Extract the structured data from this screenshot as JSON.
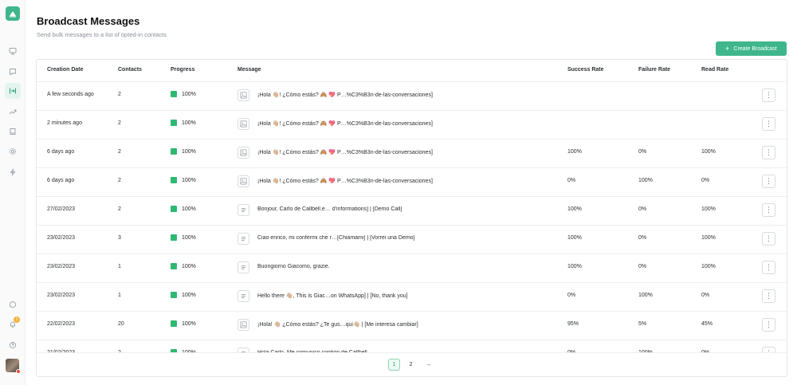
{
  "sidebar": {
    "logo": "whatsapp-home-logo",
    "items": [
      {
        "name": "monitor-icon"
      },
      {
        "name": "chat-icon"
      },
      {
        "name": "broadcast-icon",
        "active": true
      },
      {
        "name": "trending-icon"
      },
      {
        "name": "book-icon"
      },
      {
        "name": "settings-icon"
      },
      {
        "name": "lightning-icon"
      }
    ],
    "bottom": [
      {
        "name": "whatsapp-icon"
      },
      {
        "name": "bell-icon",
        "badge": "1"
      },
      {
        "name": "help-icon"
      }
    ]
  },
  "header": {
    "title": "Broadcast Messages",
    "subtitle": "Send bulk messages to a list of opted-in contacts",
    "create_button": "Create Broadcast",
    "create_icon": "+"
  },
  "accent_color": "#3fb68b",
  "table": {
    "columns": [
      "Creation Date",
      "Contacts",
      "Progress",
      "Message",
      "Success Rate",
      "Failure Rate",
      "Read Rate"
    ],
    "rows": [
      {
        "date": "A few seconds ago",
        "contacts": "2",
        "progress": "100%",
        "icon": "image-icon",
        "message": "¡Hola 👋🏼! ¿Cómo estás? 🙈 💖 P…%C3%B3n-de-las-conversaciones]",
        "success": "",
        "failure": "",
        "read": ""
      },
      {
        "date": "2 minutes ago",
        "contacts": "2",
        "progress": "100%",
        "icon": "image-icon",
        "message": "¡Hola 👋🏼! ¿Cómo estás? 🙈 💖 P…%C3%B3n-de-las-conversaciones]",
        "success": "",
        "failure": "",
        "read": ""
      },
      {
        "date": "6 days ago",
        "contacts": "2",
        "progress": "100%",
        "icon": "image-icon",
        "message": "¡Hola 👋🏼! ¿Cómo estás? 🙈 💖 P…%C3%B3n-de-las-conversaciones]",
        "success": "100%",
        "failure": "0%",
        "read": "100%"
      },
      {
        "date": "6 days ago",
        "contacts": "2",
        "progress": "100%",
        "icon": "image-icon",
        "message": "¡Hola 👋🏼! ¿Cómo estás? 🙈 💖 P…%C3%B3n-de-las-conversaciones]",
        "success": "0%",
        "failure": "100%",
        "read": "0%"
      },
      {
        "date": "27/02/2023",
        "contacts": "2",
        "progress": "100%",
        "icon": "text-icon",
        "message": "Bonjour, Carlo de Callbell.e… d'informations] | [Demo Call]",
        "success": "100%",
        "failure": "0%",
        "read": "100%"
      },
      {
        "date": "23/02/2023",
        "contacts": "3",
        "progress": "100%",
        "icon": "text-icon",
        "message": "Ciao enrico, mi confermi che r…[Chiamami] | [Vorrei una Demo]",
        "success": "100%",
        "failure": "0%",
        "read": "100%"
      },
      {
        "date": "23/02/2023",
        "contacts": "1",
        "progress": "100%",
        "icon": "text-icon",
        "message": "Buongiorno Giacomo, grazie.",
        "success": "100%",
        "failure": "0%",
        "read": "100%"
      },
      {
        "date": "23/02/2023",
        "contacts": "1",
        "progress": "100%",
        "icon": "text-icon",
        "message": "Hello there 👋🏼, This is Giac…on WhatsApp] | [No, thank you]",
        "success": "0%",
        "failure": "100%",
        "read": "0%"
      },
      {
        "date": "22/02/2023",
        "contacts": "20",
        "progress": "100%",
        "icon": "image-icon",
        "message": "¡Hola! 👋🏼 ¿Cómo estás? ¿Te gus…qui👋🏼 | [Me interesa cambiar]",
        "success": "95%",
        "failure": "5%",
        "read": "45%"
      },
      {
        "date": "21/02/2023",
        "contacts": "2",
        "progress": "100%",
        "icon": "text-icon",
        "message": "Hola Carlo, Me comunico contigo de Callbell…",
        "success": "0%",
        "failure": "100%",
        "read": "0%"
      }
    ],
    "kebab": "⋮"
  },
  "pagination": {
    "pages": [
      "1",
      "2"
    ],
    "current": "1",
    "next": "→"
  }
}
